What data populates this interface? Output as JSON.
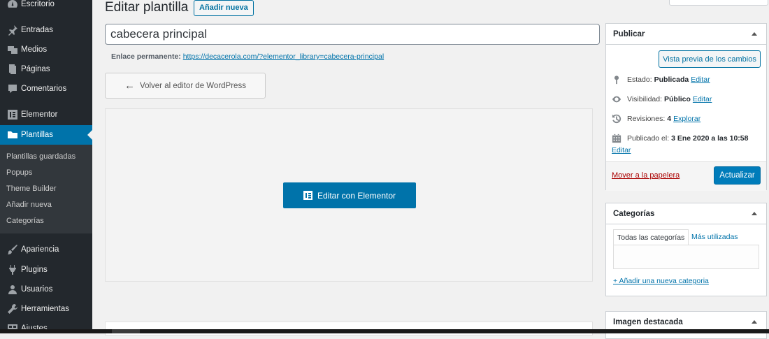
{
  "sidebar": {
    "items": [
      {
        "label": "Escritorio",
        "icon": "dashboard-icon"
      },
      {
        "label": "Entradas",
        "icon": "pin-icon"
      },
      {
        "label": "Medios",
        "icon": "media-icon"
      },
      {
        "label": "Páginas",
        "icon": "pages-icon"
      },
      {
        "label": "Comentarios",
        "icon": "comments-icon"
      },
      {
        "label": "Elementor",
        "icon": "elementor-icon"
      },
      {
        "label": "Plantillas",
        "icon": "folder-icon"
      },
      {
        "label": "Apariencia",
        "icon": "brush-icon"
      },
      {
        "label": "Plugins",
        "icon": "plug-icon"
      },
      {
        "label": "Usuarios",
        "icon": "users-icon"
      },
      {
        "label": "Herramientas",
        "icon": "wrench-icon"
      },
      {
        "label": "Ajustes",
        "icon": "settings-icon"
      }
    ],
    "submenu": [
      "Plantillas guardadas",
      "Popups",
      "Theme Builder",
      "Añadir nueva",
      "Categorías"
    ],
    "active_color": "#0073aa"
  },
  "header": {
    "title": "Editar plantilla",
    "add_new": "Añadir nueva"
  },
  "editor": {
    "title_value": "cabecera principal",
    "permalink_label": "Enlace permanente:",
    "permalink_url": "https://decacerola.com/?elementor_library=cabecera-principal",
    "back_button": "Volver al editor de WordPress",
    "edit_with_elementor": "Editar con Elementor"
  },
  "publish_box": {
    "title": "Publicar",
    "preview_button": "Vista previa de los cambios",
    "status_label": "Estado:",
    "status_value": "Publicada",
    "visibility_label": "Visibilidad:",
    "visibility_value": "Público",
    "revisions_label": "Revisiones:",
    "revisions_value": "4",
    "revisions_link": "Explorar",
    "published_label": "Publicado el:",
    "published_value": "3 Ene 2020 a las 10:58",
    "edit_link": "Editar",
    "trash_link": "Mover a la papelera",
    "update_button": "Actualizar"
  },
  "categories_box": {
    "title": "Categorías",
    "tab_all": "Todas las categorías",
    "tab_popular": "Más utilizadas",
    "add_link": "+ Añadir una nueva categoria"
  },
  "featured_box": {
    "title": "Imagen destacada"
  }
}
